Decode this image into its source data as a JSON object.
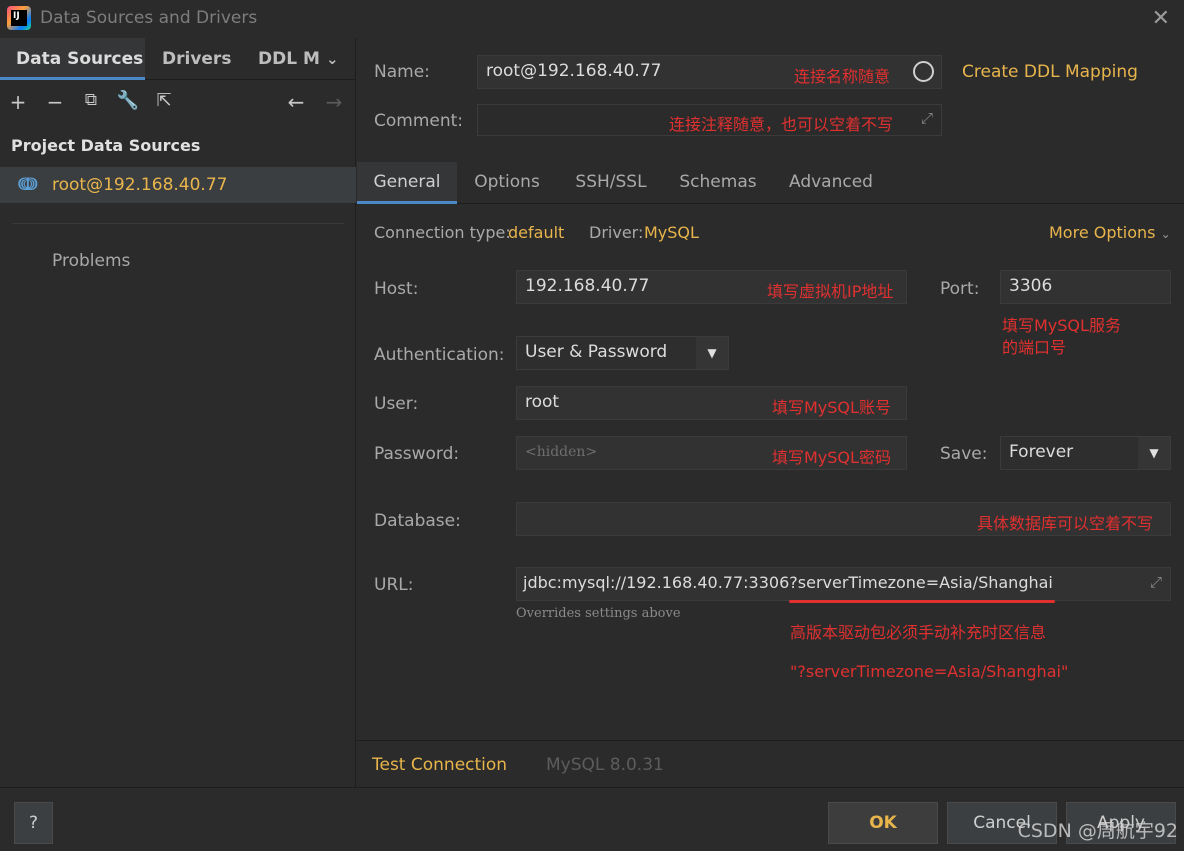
{
  "window": {
    "title": "Data Sources and Drivers"
  },
  "left": {
    "tabs": [
      "Data Sources",
      "Drivers",
      "DDL M"
    ],
    "section_title": "Project Data Sources",
    "datasource": "root@192.168.40.77",
    "problems": "Problems"
  },
  "form": {
    "name_label": "Name:",
    "name_value": "root@192.168.40.77",
    "name_anno": "连接名称随意",
    "create_ddl": "Create DDL Mapping",
    "comment_label": "Comment:",
    "comment_anno": "连接注释随意，也可以空着不写",
    "tabs": [
      "General",
      "Options",
      "SSH/SSL",
      "Schemas",
      "Advanced"
    ],
    "conn_type_label": "Connection type:",
    "conn_type_value": "default",
    "driver_label": "Driver:",
    "driver_value": "MySQL",
    "more_options": "More Options",
    "host_label": "Host:",
    "host_value": "192.168.40.77",
    "host_anno": "填写虚拟机IP地址",
    "port_label": "Port:",
    "port_value": "3306",
    "port_anno_1": "填写MySQL服务",
    "port_anno_2": "的端口号",
    "auth_label": "Authentication:",
    "auth_value": "User & Password",
    "user_label": "User:",
    "user_value": "root",
    "user_anno": "填写MySQL账号",
    "password_label": "Password:",
    "password_placeholder": "<hidden>",
    "password_anno": "填写MySQL密码",
    "save_label": "Save:",
    "save_value": "Forever",
    "database_label": "Database:",
    "database_anno": "具体数据库可以空着不写",
    "url_label": "URL:",
    "url_value": "jdbc:mysql://192.168.40.77:3306?serverTimezone=Asia/Shanghai",
    "url_hint": "Overrides settings above",
    "url_anno_1": "高版本驱动包必须手动补充时区信息",
    "url_anno_2": "\"?serverTimezone=Asia/Shanghai\"",
    "test_connection": "Test Connection",
    "mysql_version": "MySQL 8.0.31"
  },
  "footer": {
    "help": "?",
    "ok": "OK",
    "cancel": "Cancel",
    "apply": "Apply",
    "watermark": "CSDN @周航宇92"
  },
  "colors": {
    "accent": "#e8b54c",
    "annotation": "#e03030",
    "selection": "#4a88c7"
  }
}
